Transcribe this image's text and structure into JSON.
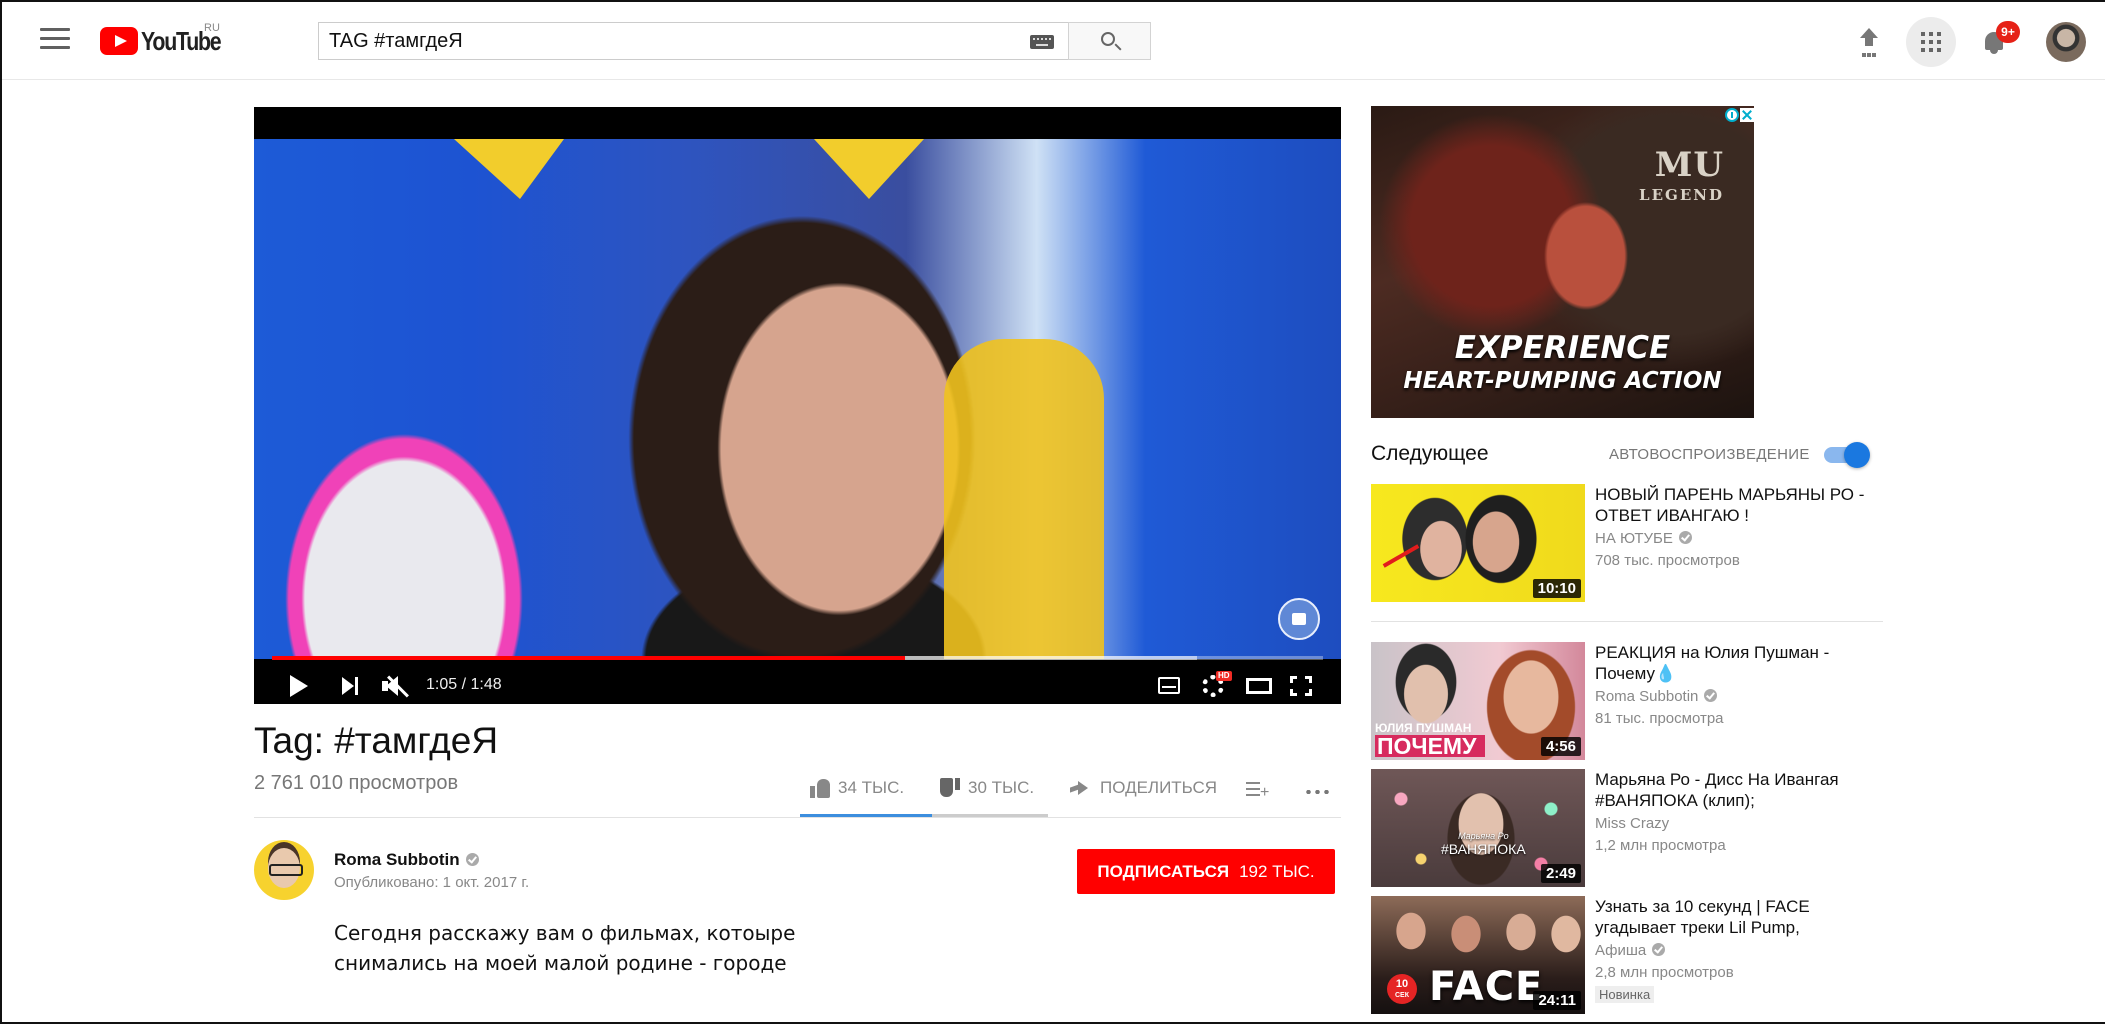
{
  "masthead": {
    "logo_text": "YouTube",
    "region": "RU",
    "search": {
      "value": "TAG #тамгдеЯ",
      "placeholder": ""
    },
    "notifications_badge": "9+",
    "icons": [
      "menu-icon",
      "keyboard-icon",
      "search-icon",
      "upload-icon",
      "apps-icon",
      "bell-icon",
      "avatar"
    ]
  },
  "player": {
    "time": "1:05 / 1:48",
    "progress_played_fraction": 0.6019,
    "progress_loaded_fraction": 0.88,
    "muted": true,
    "hd_label": "HD"
  },
  "video": {
    "title": "Tag: #тамгдеЯ",
    "views": "2 761 010 просмотров",
    "likes": "34 ТЫС.",
    "dislikes": "30 ТЫС.",
    "share": "ПОДЕЛИТЬСЯ",
    "like_ratio": 0.531
  },
  "channel": {
    "name": "Roma Subbotin",
    "published": "Опубликовано: 1 окт. 2017 г.",
    "subscribe_label": "ПОДПИСАТЬСЯ",
    "subscriber_count": "192 ТЫС.",
    "description_lines": [
      "Сегодня расскажу вам о фильмах, котоыре",
      "снимались на моей малой родине - городе"
    ]
  },
  "ad": {
    "logo": "MU",
    "logo_sub": "LEGEND",
    "headline": "EXPERIENCE",
    "subline": "HEART-PUMPING ACTION"
  },
  "sidebar": {
    "up_next_label": "Следующее",
    "autoplay_label": "АВТОВОСПРОИЗВЕДЕНИЕ",
    "autoplay_on": true,
    "recommendations": [
      {
        "title": "НОВЫЙ ПАРЕНЬ МАРЬЯНЫ РО - ОТВЕТ ИВАНГАЮ !",
        "channel": "НА ЮТУБЕ",
        "verified": true,
        "views": "708 тыс. просмотров",
        "duration": "10:10",
        "badge": ""
      },
      {
        "title": "РЕАКЦИЯ на Юлия Пушман - Почему💧",
        "channel": "Roma Subbotin",
        "verified": true,
        "views": "81 тыс. просмотра",
        "duration": "4:56",
        "badge": "",
        "thumb_caption_top": "ЮЛИЯ ПУШМАН",
        "thumb_caption_big": "ПОЧЕМУ"
      },
      {
        "title": "Марьяна Ро - Дисс На Ивангая #ВАНЯПОКА (клип);",
        "channel": "Miss Crazy",
        "verified": false,
        "views": "1,2 млн просмотра",
        "duration": "2:49",
        "badge": "",
        "thumb_caption_small": "Марьяна Ро",
        "thumb_caption": "#ВАНЯПОКА"
      },
      {
        "title": "Узнать за 10 секунд | FACE угадывает треки Lil Pump,",
        "channel": "Афиша",
        "verified": true,
        "views": "2,8 млн просмотров",
        "duration": "24:11",
        "badge": "Новинка",
        "thumb_word": "FACE",
        "thumb_chip": "10",
        "thumb_chip_sub": "СЕК"
      }
    ]
  }
}
